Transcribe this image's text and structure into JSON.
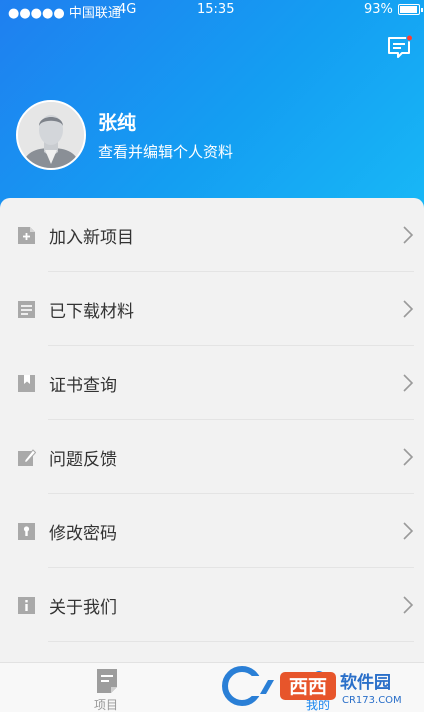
{
  "status_bar": {
    "carrier": "●●●●● 中国联通",
    "network": "4G",
    "time": "15:35",
    "battery": "93%"
  },
  "header": {
    "gradient_start": "#1f7ff0",
    "gradient_end": "#18b8f6",
    "message_icon": "message-badge-icon"
  },
  "profile": {
    "name": "张纯",
    "subtitle": "查看并编辑个人资料",
    "avatar_icon": "user-avatar"
  },
  "menu": {
    "items": [
      {
        "label": "加入新项目",
        "icon": "add-document-icon"
      },
      {
        "label": "已下载材料",
        "icon": "download-list-icon"
      },
      {
        "label": "证书查询",
        "icon": "bookmark-certificate-icon"
      },
      {
        "label": "问题反馈",
        "icon": "edit-feedback-icon"
      },
      {
        "label": "修改密码",
        "icon": "lock-icon"
      },
      {
        "label": "关于我们",
        "icon": "info-icon"
      }
    ]
  },
  "tab_bar": {
    "tabs": [
      {
        "label": "项目",
        "icon": "project-doc-icon",
        "active": false
      },
      {
        "label": "我的",
        "icon": "profile-icon",
        "active": true
      }
    ],
    "active_color": "#1a86ee",
    "inactive_color": "#999999"
  },
  "watermark": {
    "logo_text": "西西",
    "site_name": "软件园",
    "site_url": "CR173.COM"
  }
}
